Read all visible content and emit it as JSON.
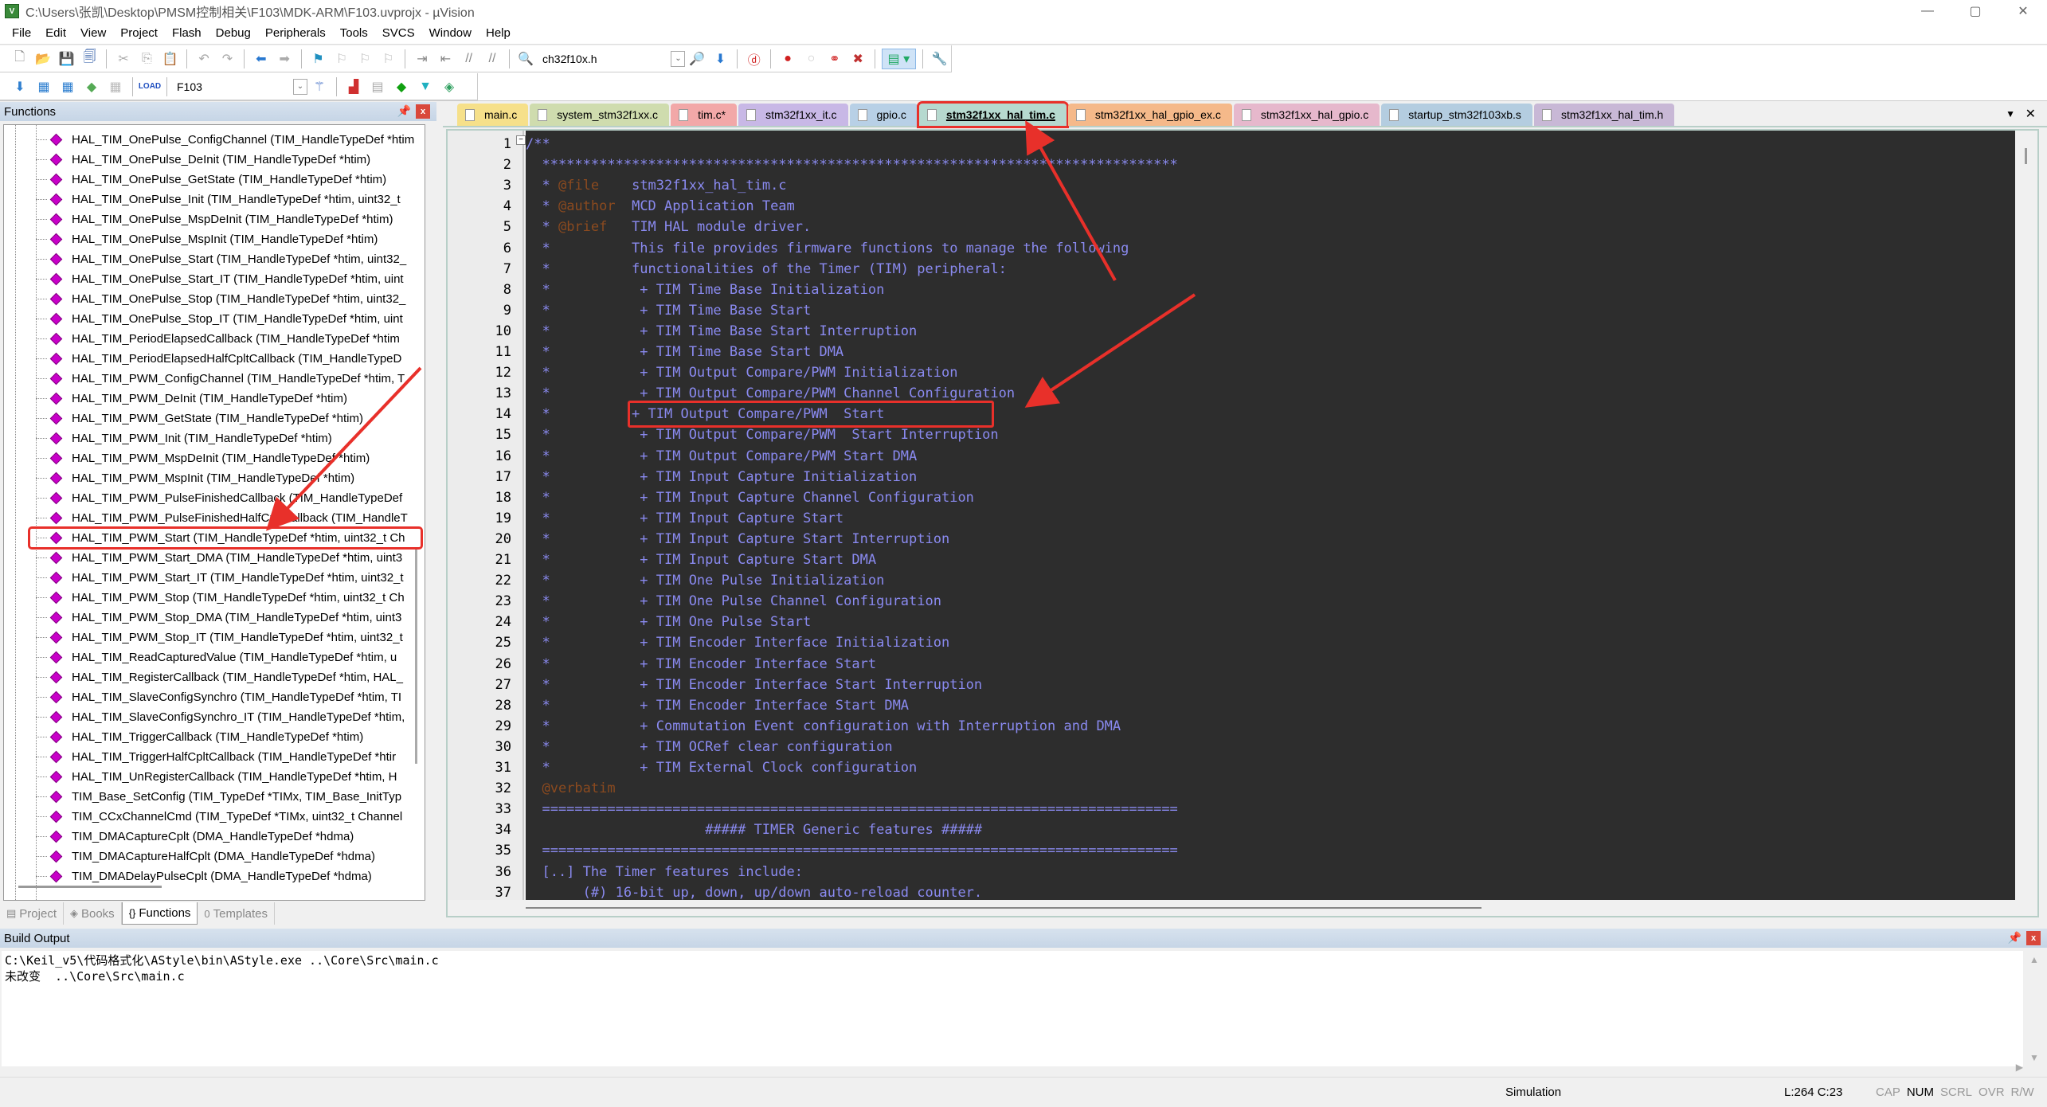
{
  "window": {
    "title": "C:\\Users\\张凯\\Desktop\\PMSM控制相关\\F103\\MDK-ARM\\F103.uvprojx - µVision",
    "controls": [
      "—",
      "▢",
      "✕"
    ]
  },
  "menu": [
    "File",
    "Edit",
    "View",
    "Project",
    "Flash",
    "Debug",
    "Peripherals",
    "Tools",
    "SVCS",
    "Window",
    "Help"
  ],
  "toolbar1": {
    "find_combo_value": "ch32f10x.h"
  },
  "toolbar2": {
    "target_combo_value": "F103"
  },
  "functions_panel": {
    "title": "Functions",
    "items": [
      "HAL_TIM_OnePulse_ConfigChannel (TIM_HandleTypeDef *htim",
      "HAL_TIM_OnePulse_DeInit (TIM_HandleTypeDef *htim)",
      "HAL_TIM_OnePulse_GetState (TIM_HandleTypeDef *htim)",
      "HAL_TIM_OnePulse_Init (TIM_HandleTypeDef *htim, uint32_t",
      "HAL_TIM_OnePulse_MspDeInit (TIM_HandleTypeDef *htim)",
      "HAL_TIM_OnePulse_MspInit (TIM_HandleTypeDef *htim)",
      "HAL_TIM_OnePulse_Start (TIM_HandleTypeDef *htim, uint32_",
      "HAL_TIM_OnePulse_Start_IT (TIM_HandleTypeDef *htim, uint",
      "HAL_TIM_OnePulse_Stop (TIM_HandleTypeDef *htim, uint32_",
      "HAL_TIM_OnePulse_Stop_IT (TIM_HandleTypeDef *htim, uint",
      "HAL_TIM_PeriodElapsedCallback (TIM_HandleTypeDef *htim",
      "HAL_TIM_PeriodElapsedHalfCpltCallback (TIM_HandleTypeD",
      "HAL_TIM_PWM_ConfigChannel (TIM_HandleTypeDef *htim, T",
      "HAL_TIM_PWM_DeInit (TIM_HandleTypeDef *htim)",
      "HAL_TIM_PWM_GetState (TIM_HandleTypeDef *htim)",
      "HAL_TIM_PWM_Init (TIM_HandleTypeDef *htim)",
      "HAL_TIM_PWM_MspDeInit (TIM_HandleTypeDef *htim)",
      "HAL_TIM_PWM_MspInit (TIM_HandleTypeDef *htim)",
      "HAL_TIM_PWM_PulseFinishedCallback (TIM_HandleTypeDef",
      "HAL_TIM_PWM_PulseFinishedHalfCpltCallback (TIM_HandleT",
      "HAL_TIM_PWM_Start (TIM_HandleTypeDef *htim, uint32_t Ch",
      "HAL_TIM_PWM_Start_DMA (TIM_HandleTypeDef *htim, uint3",
      "HAL_TIM_PWM_Start_IT (TIM_HandleTypeDef *htim, uint32_t",
      "HAL_TIM_PWM_Stop (TIM_HandleTypeDef *htim, uint32_t Ch",
      "HAL_TIM_PWM_Stop_DMA (TIM_HandleTypeDef *htim, uint3",
      "HAL_TIM_PWM_Stop_IT (TIM_HandleTypeDef *htim, uint32_t",
      "HAL_TIM_ReadCapturedValue (TIM_HandleTypeDef *htim, u",
      "HAL_TIM_RegisterCallback (TIM_HandleTypeDef *htim, HAL_",
      "HAL_TIM_SlaveConfigSynchro (TIM_HandleTypeDef *htim, TI",
      "HAL_TIM_SlaveConfigSynchro_IT (TIM_HandleTypeDef *htim,",
      "HAL_TIM_TriggerCallback (TIM_HandleTypeDef *htim)",
      "HAL_TIM_TriggerHalfCpltCallback (TIM_HandleTypeDef *htir",
      "HAL_TIM_UnRegisterCallback (TIM_HandleTypeDef *htim, H",
      "TIM_Base_SetConfig (TIM_TypeDef *TIMx, TIM_Base_InitTyp",
      "TIM_CCxChannelCmd (TIM_TypeDef *TIMx, uint32_t Channel",
      "TIM_DMACaptureCplt (DMA_HandleTypeDef *hdma)",
      "TIM_DMACaptureHalfCplt (DMA_HandleTypeDef *hdma)",
      "TIM_DMADelayPulseCplt (DMA_HandleTypeDef *hdma)"
    ],
    "highlighted_index": 20,
    "tabs": [
      {
        "label": "Project",
        "icon": "▤"
      },
      {
        "label": "Books",
        "icon": "◈"
      },
      {
        "label": "Functions",
        "icon": "{}"
      },
      {
        "label": "Templates",
        "icon": "0"
      }
    ],
    "active_tab": 2
  },
  "editor": {
    "tabs": [
      {
        "label": "main.c",
        "color": "#f6e08a"
      },
      {
        "label": "system_stm32f1xx.c",
        "color": "#cfdcae"
      },
      {
        "label": "tim.c*",
        "color": "#f2a8a8"
      },
      {
        "label": "stm32f1xx_it.c",
        "color": "#c8b8e6"
      },
      {
        "label": "gpio.c",
        "color": "#b8d0e6"
      },
      {
        "label": "stm32f1xx_hal_tim.c",
        "color": "#b6d9cf"
      },
      {
        "label": "stm32f1xx_hal_gpio_ex.c",
        "color": "#f5b98a"
      },
      {
        "label": "stm32f1xx_hal_gpio.c",
        "color": "#e6b8cc"
      },
      {
        "label": "startup_stm32f103xb.s",
        "color": "#b4cde0"
      },
      {
        "label": "stm32f1xx_hal_tim.h",
        "color": "#c8b8d6"
      }
    ],
    "active_tab": 5,
    "highlighted_line": 14,
    "lines": [
      {
        "n": "1",
        "tag": "",
        "text": "/**"
      },
      {
        "n": "2",
        "tag": "",
        "text": "  ******************************************************************************"
      },
      {
        "n": "3",
        "tag": "@file",
        "pre": "  * ",
        "text": "    stm32f1xx_hal_tim.c"
      },
      {
        "n": "4",
        "tag": "@author",
        "pre": "  * ",
        "text": "  MCD Application Team"
      },
      {
        "n": "5",
        "tag": "@brief",
        "pre": "  * ",
        "text": "   TIM HAL module driver."
      },
      {
        "n": "6",
        "tag": "",
        "text": "  *          This file provides firmware functions to manage the following"
      },
      {
        "n": "7",
        "tag": "",
        "text": "  *          functionalities of the Timer (TIM) peripheral:"
      },
      {
        "n": "8",
        "tag": "",
        "text": "  *           + TIM Time Base Initialization"
      },
      {
        "n": "9",
        "tag": "",
        "text": "  *           + TIM Time Base Start"
      },
      {
        "n": "10",
        "tag": "",
        "text": "  *           + TIM Time Base Start Interruption"
      },
      {
        "n": "11",
        "tag": "",
        "text": "  *           + TIM Time Base Start DMA"
      },
      {
        "n": "12",
        "tag": "",
        "text": "  *           + TIM Output Compare/PWM Initialization"
      },
      {
        "n": "13",
        "tag": "",
        "text": "  *           + TIM Output Compare/PWM Channel Configuration"
      },
      {
        "n": "14",
        "tag": "",
        "text": "  *          + TIM Output Compare/PWM  Start"
      },
      {
        "n": "15",
        "tag": "",
        "text": "  *           + TIM Output Compare/PWM  Start Interruption"
      },
      {
        "n": "16",
        "tag": "",
        "text": "  *           + TIM Output Compare/PWM Start DMA"
      },
      {
        "n": "17",
        "tag": "",
        "text": "  *           + TIM Input Capture Initialization"
      },
      {
        "n": "18",
        "tag": "",
        "text": "  *           + TIM Input Capture Channel Configuration"
      },
      {
        "n": "19",
        "tag": "",
        "text": "  *           + TIM Input Capture Start"
      },
      {
        "n": "20",
        "tag": "",
        "text": "  *           + TIM Input Capture Start Interruption"
      },
      {
        "n": "21",
        "tag": "",
        "text": "  *           + TIM Input Capture Start DMA"
      },
      {
        "n": "22",
        "tag": "",
        "text": "  *           + TIM One Pulse Initialization"
      },
      {
        "n": "23",
        "tag": "",
        "text": "  *           + TIM One Pulse Channel Configuration"
      },
      {
        "n": "24",
        "tag": "",
        "text": "  *           + TIM One Pulse Start"
      },
      {
        "n": "25",
        "tag": "",
        "text": "  *           + TIM Encoder Interface Initialization"
      },
      {
        "n": "26",
        "tag": "",
        "text": "  *           + TIM Encoder Interface Start"
      },
      {
        "n": "27",
        "tag": "",
        "text": "  *           + TIM Encoder Interface Start Interruption"
      },
      {
        "n": "28",
        "tag": "",
        "text": "  *           + TIM Encoder Interface Start DMA"
      },
      {
        "n": "29",
        "tag": "",
        "text": "  *           + Commutation Event configuration with Interruption and DMA"
      },
      {
        "n": "30",
        "tag": "",
        "text": "  *           + TIM OCRef clear configuration"
      },
      {
        "n": "31",
        "tag": "",
        "text": "  *           + TIM External Clock configuration"
      },
      {
        "n": "32",
        "tag": "@verbatim",
        "pre": "  ",
        "text": ""
      },
      {
        "n": "33",
        "tag": "",
        "text": "  =============================================================================="
      },
      {
        "n": "34",
        "tag": "",
        "text": "                      ##### TIMER Generic features #####"
      },
      {
        "n": "35",
        "tag": "",
        "text": "  =============================================================================="
      },
      {
        "n": "36",
        "tag": "",
        "text": "  [..] The Timer features include:"
      },
      {
        "n": "37",
        "tag": "",
        "text": "       (#) 16-bit up, down, up/down auto-reload counter."
      }
    ]
  },
  "build_output": {
    "title": "Build Output",
    "lines": [
      "C:\\Keil_v5\\代码格式化\\AStyle\\bin\\AStyle.exe ..\\Core\\Src\\main.c",
      "未改变  ..\\Core\\Src\\main.c"
    ]
  },
  "statusbar": {
    "mode": "Simulation",
    "position": "L:264 C:23",
    "keys": [
      {
        "label": "CAP",
        "on": false
      },
      {
        "label": "NUM",
        "on": true
      },
      {
        "label": "SCRL",
        "on": false
      },
      {
        "label": "OVR",
        "on": false
      },
      {
        "label": "R/W",
        "on": false
      }
    ]
  },
  "annotation_color": "#e8302a"
}
